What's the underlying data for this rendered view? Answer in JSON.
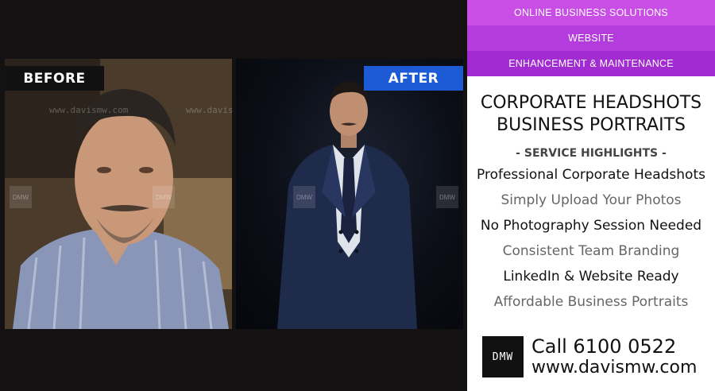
{
  "before_label": "BEFORE",
  "after_label": "AFTER",
  "watermark": "www.davismw.com",
  "nav": [
    "ONLINE BUSINESS SOLUTIONS",
    "WEBSITE",
    "ENHANCEMENT & MAINTENANCE"
  ],
  "title_line1": "CORPORATE HEADSHOTS",
  "title_line2": "BUSINESS PORTRAITS",
  "highlights_heading": "- SERVICE HIGHLIGHTS -",
  "highlights": [
    "Professional Corporate Headshots",
    "Simply Upload Your Photos",
    "No Photography Session Needed",
    "Consistent Team Branding",
    "LinkedIn & Website Ready",
    "Affordable Business Portraits"
  ],
  "logo_text": "DMW",
  "phone": "Call 6100 0522",
  "website": "www.davismw.com",
  "colors": {
    "after_badge": "#1c5ad6",
    "nav_1": "#c84ee6",
    "nav_2": "#b43cdd",
    "nav_3": "#a22bd1"
  }
}
